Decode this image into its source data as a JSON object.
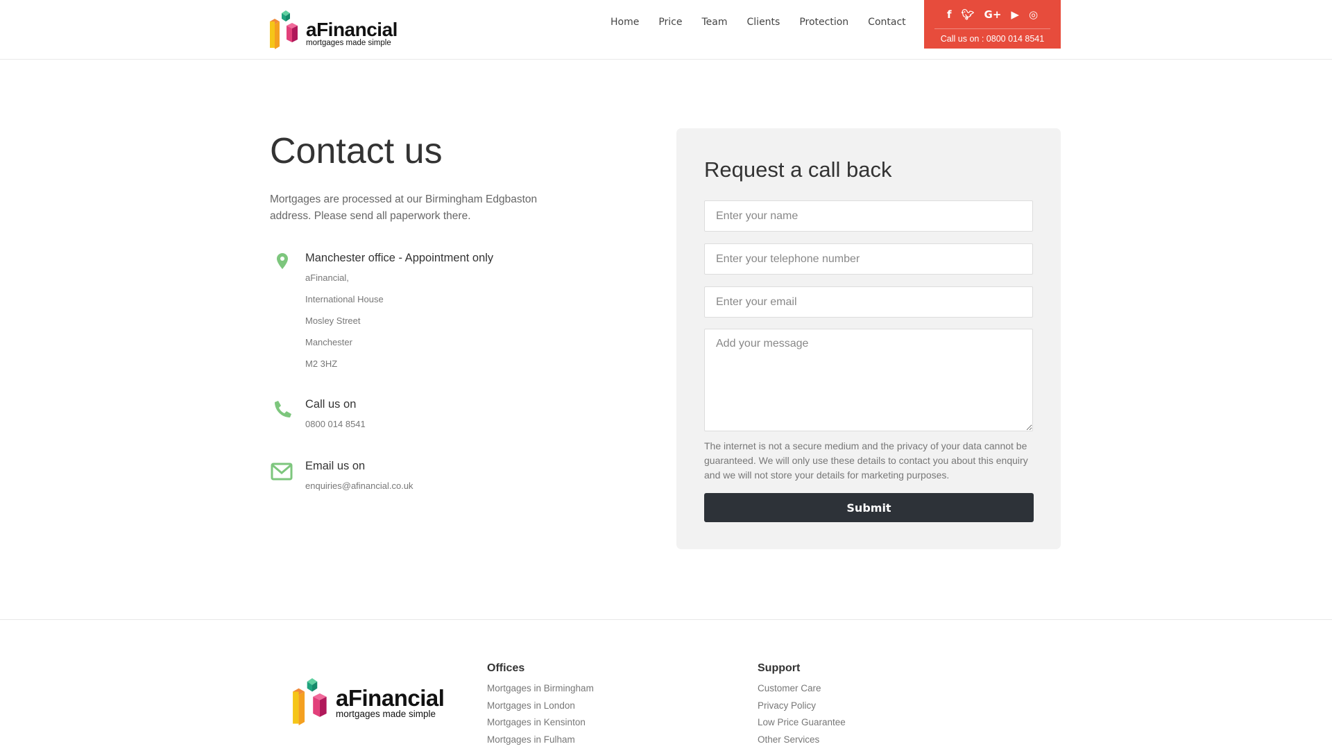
{
  "brand": {
    "name": "aFinancial",
    "tagline": "mortgages made simple"
  },
  "nav": [
    "Home",
    "Price",
    "Team",
    "Clients",
    "Protection",
    "Contact"
  ],
  "topbar": {
    "social": [
      "facebook-icon",
      "twitter-icon",
      "google-plus-icon",
      "youtube-icon",
      "instagram-icon"
    ],
    "call": "Call us on : 0800 014 8541",
    "color": "#e74c3c"
  },
  "main": {
    "title": "Contact us",
    "intro": "Mortgages are processed at our Birmingham Edgbaston address. Please send all paperwork there.",
    "office": {
      "title": "Manchester office - Appointment only",
      "lines": [
        "aFinancial,",
        "International House",
        "Mosley Street",
        "Manchester",
        "M2 3HZ"
      ]
    },
    "call": {
      "title": "Call us on",
      "value": "0800 014 8541"
    },
    "email": {
      "title": "Email us on",
      "value": "enquiries@afinancial.co.uk"
    },
    "icon_color": "#7dc67d"
  },
  "form": {
    "title": "Request a call back",
    "name_placeholder": "Enter your name",
    "phone_placeholder": "Enter your telephone number",
    "email_placeholder": "Enter your email",
    "message_placeholder": "Add your message",
    "privacy": "The internet is not a secure medium and the privacy of your data cannot be guaranteed. We will only use these details to contact you about this enquiry and we will not store your details for marketing purposes.",
    "submit": "Submit"
  },
  "footer": {
    "offices": {
      "title": "Offices",
      "links": [
        "Mortgages in Birmingham",
        "Mortgages in London",
        "Mortgages in Kensinton",
        "Mortgages in Fulham"
      ]
    },
    "support": {
      "title": "Support",
      "links": [
        "Customer Care",
        "Privacy Policy",
        "Low Price Guarantee",
        "Other Services"
      ]
    }
  }
}
